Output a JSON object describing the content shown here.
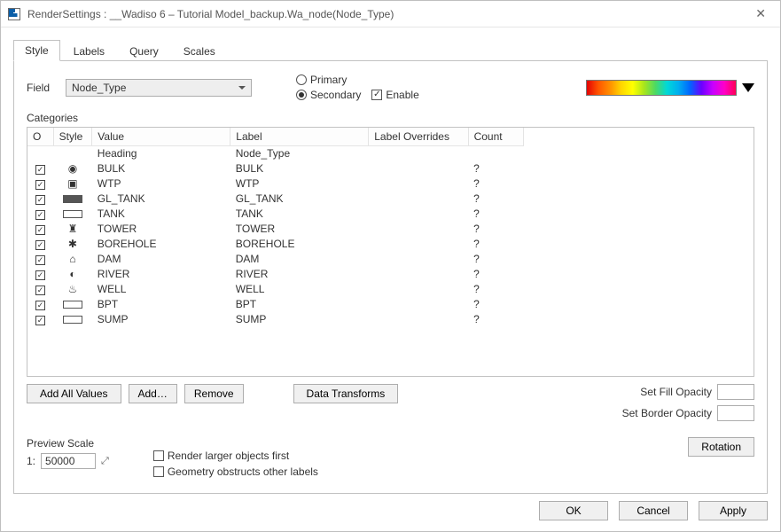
{
  "window": {
    "title": "RenderSettings : __Wadiso 6 – Tutorial Model_backup.Wa_node(Node_Type)"
  },
  "tabs": [
    {
      "label": "Style",
      "active": true
    },
    {
      "label": "Labels",
      "active": false
    },
    {
      "label": "Query",
      "active": false
    },
    {
      "label": "Scales",
      "active": false
    }
  ],
  "field": {
    "label": "Field",
    "value": "Node_Type"
  },
  "radios": {
    "primary_label": "Primary",
    "secondary_label": "Secondary",
    "selected": "secondary"
  },
  "enable": {
    "label": "Enable",
    "checked": true
  },
  "categories_label": "Categories",
  "columns": {
    "o": "O",
    "style": "Style",
    "value": "Value",
    "label": "Label",
    "over": "Label Overrides",
    "count": "Count"
  },
  "heading_row": {
    "value": "Heading",
    "label": "Node_Type"
  },
  "rows": [
    {
      "checked": true,
      "styleIcon": "eye",
      "value": "BULK",
      "label": "BULK",
      "count": "?"
    },
    {
      "checked": true,
      "styleIcon": "box-dot",
      "value": "WTP",
      "label": "WTP",
      "count": "?"
    },
    {
      "checked": true,
      "styleIcon": "rect-fill",
      "value": "GL_TANK",
      "label": "GL_TANK",
      "count": "?"
    },
    {
      "checked": true,
      "styleIcon": "rect",
      "value": "TANK",
      "label": "TANK",
      "count": "?"
    },
    {
      "checked": true,
      "styleIcon": "tower",
      "value": "TOWER",
      "label": "TOWER",
      "count": "?"
    },
    {
      "checked": true,
      "styleIcon": "borehole",
      "value": "BOREHOLE",
      "label": "BOREHOLE",
      "count": "?"
    },
    {
      "checked": true,
      "styleIcon": "dam",
      "value": "DAM",
      "label": "DAM",
      "count": "?"
    },
    {
      "checked": true,
      "styleIcon": "river",
      "value": "RIVER",
      "label": "RIVER",
      "count": "?"
    },
    {
      "checked": true,
      "styleIcon": "well",
      "value": "WELL",
      "label": "WELL",
      "count": "?"
    },
    {
      "checked": true,
      "styleIcon": "rect",
      "value": "BPT",
      "label": "BPT",
      "count": "?"
    },
    {
      "checked": true,
      "styleIcon": "rect",
      "value": "SUMP",
      "label": "SUMP",
      "count": "?"
    }
  ],
  "buttons": {
    "add_all": "Add All Values",
    "add": "Add…",
    "remove": "Remove",
    "transforms": "Data Transforms",
    "rotation": "Rotation"
  },
  "opacity": {
    "fill_label": "Set Fill Opacity",
    "border_label": "Set Border Opacity",
    "fill_value": "",
    "border_value": ""
  },
  "preview": {
    "label": "Preview Scale",
    "prefix": "1:",
    "value": "50000"
  },
  "render_opts": {
    "larger_first": {
      "label": "Render larger objects first",
      "checked": false
    },
    "obstruct": {
      "label": "Geometry obstructs other labels",
      "checked": false
    }
  },
  "footer": {
    "ok": "OK",
    "cancel": "Cancel",
    "apply": "Apply"
  }
}
